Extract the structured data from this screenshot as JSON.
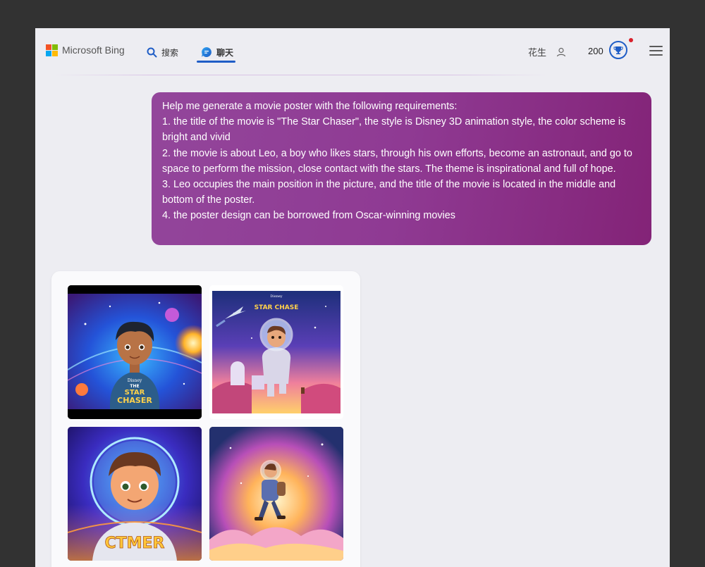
{
  "header": {
    "brand": "Microsoft Bing",
    "nav_search": "搜索",
    "nav_chat": "聊天",
    "username": "花生",
    "points": "200"
  },
  "message": {
    "lines": [
      "Help me generate a movie poster with the following requirements:",
      "1. the title of the movie is \"The Star Chaser\", the style is Disney 3D animation style, the color scheme is bright and vivid",
      "2. the movie is about Leo, a boy who likes stars, through his own efforts, become an astronaut, and go to space to perform the mission, close contact with the stars. The theme is inspirational and full of hope.",
      "3. Leo occupies the main position in the picture, and the title of the movie is located in the middle and bottom of the poster.",
      "4. the poster design can be borrowed from Oscar-winning movies"
    ]
  },
  "images": [
    {
      "logo": "Disney",
      "title_line1": "THE",
      "title_line2": "STAR",
      "title_line3": "CHASER"
    },
    {
      "logo": "Disney",
      "title": "STAR CHASE"
    },
    {
      "title": "CTMER"
    },
    {}
  ],
  "colors": {
    "accent": "#1f5dc6",
    "bubble": "#8f3a93",
    "window_bg": "#ededf2",
    "frame_bg": "#323232"
  },
  "icons": [
    "microsoft-logo-icon",
    "search-icon",
    "chat-icon",
    "user-icon",
    "rewards-icon",
    "menu-icon"
  ]
}
